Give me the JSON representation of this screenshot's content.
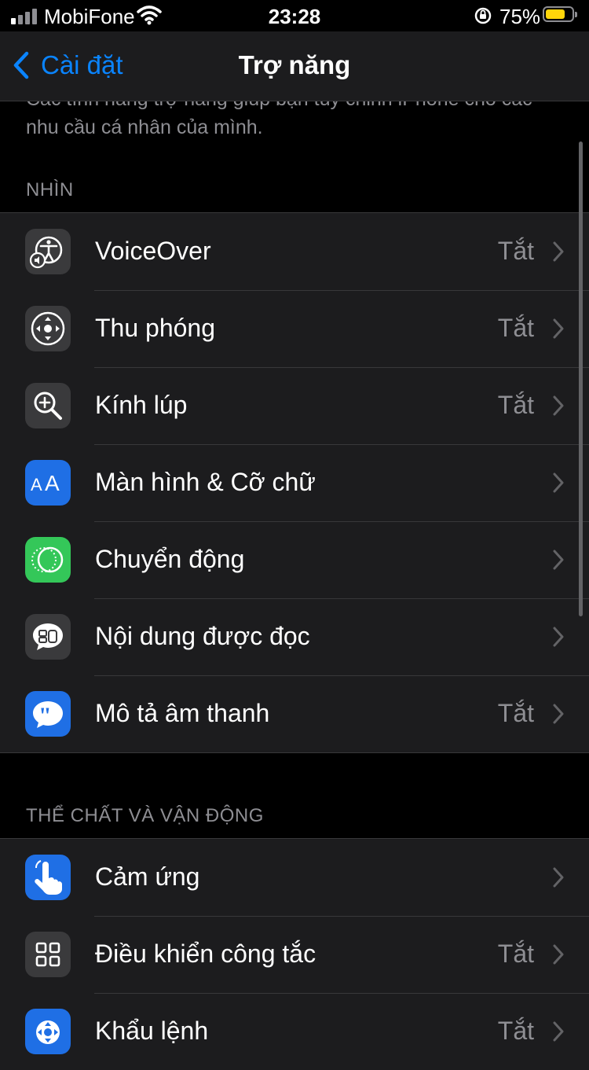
{
  "status_bar": {
    "carrier": "MobiFone",
    "time": "23:28",
    "battery_percent": "75%",
    "battery_level": 0.75,
    "signal_bars_on": 1,
    "signal_bars_total": 4
  },
  "nav": {
    "back_label": "Cài đặt",
    "title": "Trợ năng"
  },
  "description": "Các tính năng trợ năng giúp bạn tùy chỉnh iPhone cho các nhu cầu cá nhân của mình.",
  "sections": [
    {
      "header": "NHÌN",
      "items": [
        {
          "label": "VoiceOver",
          "value": "Tắt",
          "icon": "voiceover-icon",
          "icon_color": "#3a3a3c"
        },
        {
          "label": "Thu phóng",
          "value": "Tắt",
          "icon": "zoom-icon",
          "icon_color": "#3a3a3c"
        },
        {
          "label": "Kính lúp",
          "value": "Tắt",
          "icon": "magnifier-icon",
          "icon_color": "#3a3a3c"
        },
        {
          "label": "Màn hình & Cỡ chữ",
          "value": "",
          "icon": "text-size-icon",
          "icon_color": "#1f6fe5"
        },
        {
          "label": "Chuyển động",
          "value": "",
          "icon": "motion-icon",
          "icon_color": "#34c759"
        },
        {
          "label": "Nội dung được đọc",
          "value": "",
          "icon": "spoken-content-icon",
          "icon_color": "#3a3a3c"
        },
        {
          "label": "Mô tả âm thanh",
          "value": "Tắt",
          "icon": "audio-description-icon",
          "icon_color": "#1f6fe5"
        }
      ]
    },
    {
      "header": "THỂ CHẤT VÀ VẬN ĐỘNG",
      "items": [
        {
          "label": "Cảm ứng",
          "value": "",
          "icon": "touch-icon",
          "icon_color": "#1f6fe5"
        },
        {
          "label": "Điều khiển công tắc",
          "value": "Tắt",
          "icon": "switch-control-icon",
          "icon_color": "#3a3a3c"
        },
        {
          "label": "Khẩu lệnh",
          "value": "Tắt",
          "icon": "voice-control-icon",
          "icon_color": "#1f6fe5"
        }
      ]
    }
  ],
  "colors": {
    "accent": "#0a84ff",
    "background": "#000000",
    "cell": "#1c1c1e",
    "secondary_text": "#8e8e93",
    "battery": "#ffd60a"
  }
}
